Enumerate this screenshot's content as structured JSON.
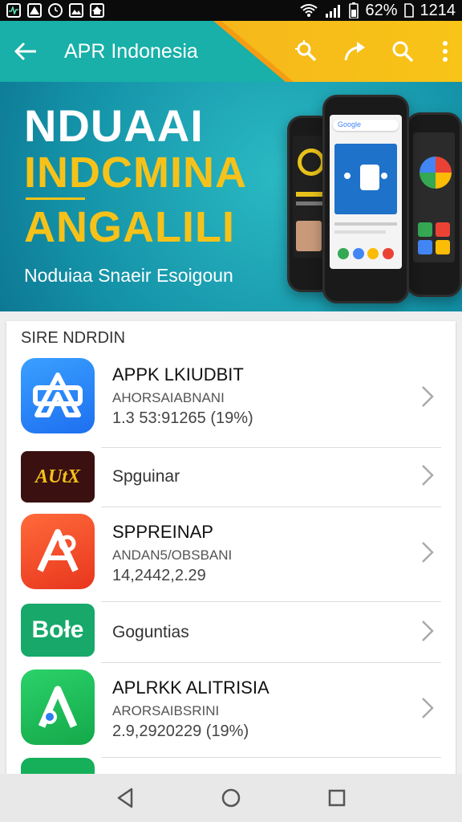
{
  "status_bar": {
    "left_icons": [
      "activity-icon",
      "a-icon",
      "timer-icon",
      "image-icon",
      "house-icon"
    ],
    "battery": "62%",
    "time": "1214"
  },
  "app_bar": {
    "title": "APR Indonesia",
    "actions": [
      "magic-icon",
      "share-icon",
      "search-icon",
      "more-icon"
    ],
    "colors": {
      "teal": "#18b0a8",
      "yellow": "#f6b81b"
    }
  },
  "banner": {
    "line1": "NDUAAI",
    "line2": "INDCMINA",
    "line3": "ANGALILI",
    "tagline": "Noduiaa Snaeir Esoigoun",
    "phone_center": {
      "search_brand": "Google"
    }
  },
  "section": {
    "heading": "SIRE NDRDIN",
    "apps": [
      {
        "name": "APPK LKIUDBIT",
        "developer": "AHORSAIABNANI",
        "meta": "1.3 53:91265 (19%)",
        "icon": "app-store-icon",
        "icon_color": "#2b86f5"
      },
      {
        "name": "",
        "subtitle": "Spguinar",
        "logo_text": "AUtX",
        "icon": "aux-logo-icon",
        "icon_color": "#3a1010"
      },
      {
        "name": "SPPREINAP",
        "developer": "ANDAN5/OBSBANI",
        "meta": "14,2442,2.29",
        "icon": "red-a-icon",
        "icon_color": "#f24a2a"
      },
      {
        "name": "",
        "subtitle": "Goguntias",
        "logo_text": "Bołe",
        "icon": "bole-logo-icon",
        "icon_color": "#16a66a"
      },
      {
        "name": "APLRKK ALITRISIA",
        "developer": "ARORSAIBSRINI",
        "meta": "2.9,2920229 (19%)",
        "icon": "green-a-icon",
        "icon_color": "#18b45a"
      }
    ]
  },
  "nav_bar": {
    "buttons": [
      "back-nav-icon",
      "home-nav-icon",
      "recents-nav-icon"
    ]
  }
}
